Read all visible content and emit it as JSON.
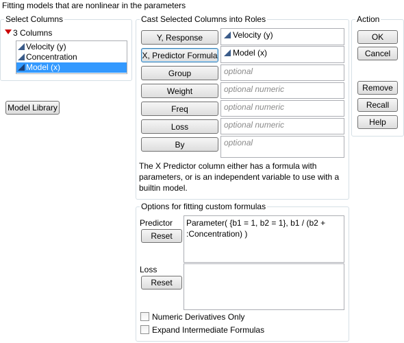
{
  "header": {
    "title": "Fitting models that are nonlinear in the parameters"
  },
  "select_columns": {
    "title": "Select Columns",
    "count_label": "3 Columns",
    "columns": [
      {
        "name": "Velocity (y)",
        "selected": false
      },
      {
        "name": "Concentration",
        "selected": false
      },
      {
        "name": "Model (x)",
        "selected": true
      }
    ]
  },
  "model_library_label": "Model Library",
  "roles": {
    "title": "Cast Selected Columns into Roles",
    "items": [
      {
        "button": "Y, Response",
        "value": "Velocity (y)",
        "placeholder": ""
      },
      {
        "button": "X, Predictor Formula",
        "value": "Model (x)",
        "placeholder": ""
      },
      {
        "button": "Group",
        "value": "",
        "placeholder": "optional"
      },
      {
        "button": "Weight",
        "value": "",
        "placeholder": "optional numeric"
      },
      {
        "button": "Freq",
        "value": "",
        "placeholder": "optional numeric"
      },
      {
        "button": "Loss",
        "value": "",
        "placeholder": "optional numeric"
      },
      {
        "button": "By",
        "value": "",
        "placeholder": "optional"
      }
    ],
    "description": "The X Predictor column either has a formula with parameters, or is an independent variable to use with a builtin model."
  },
  "action": {
    "title": "Action",
    "ok": "OK",
    "cancel": "Cancel",
    "remove": "Remove",
    "recall": "Recall",
    "help": "Help"
  },
  "options": {
    "title": "Options for fitting custom formulas",
    "predictor_label": "Predictor",
    "predictor_reset": "Reset",
    "predictor_formula": "Parameter( {b1 = 1, b2 = 1}, b1 / (b2 + :Concentration) )",
    "loss_label": "Loss",
    "loss_reset": "Reset",
    "loss_formula": "",
    "numeric_derivatives_label": "Numeric Derivatives Only",
    "numeric_derivatives_checked": false,
    "expand_formulas_label": "Expand Intermediate Formulas",
    "expand_formulas_checked": false
  },
  "colors": {
    "selection": "#3399ff",
    "group_border": "#d5dfe5",
    "menu_red": "#cc0000",
    "column_icon": "#3b5c8a"
  }
}
